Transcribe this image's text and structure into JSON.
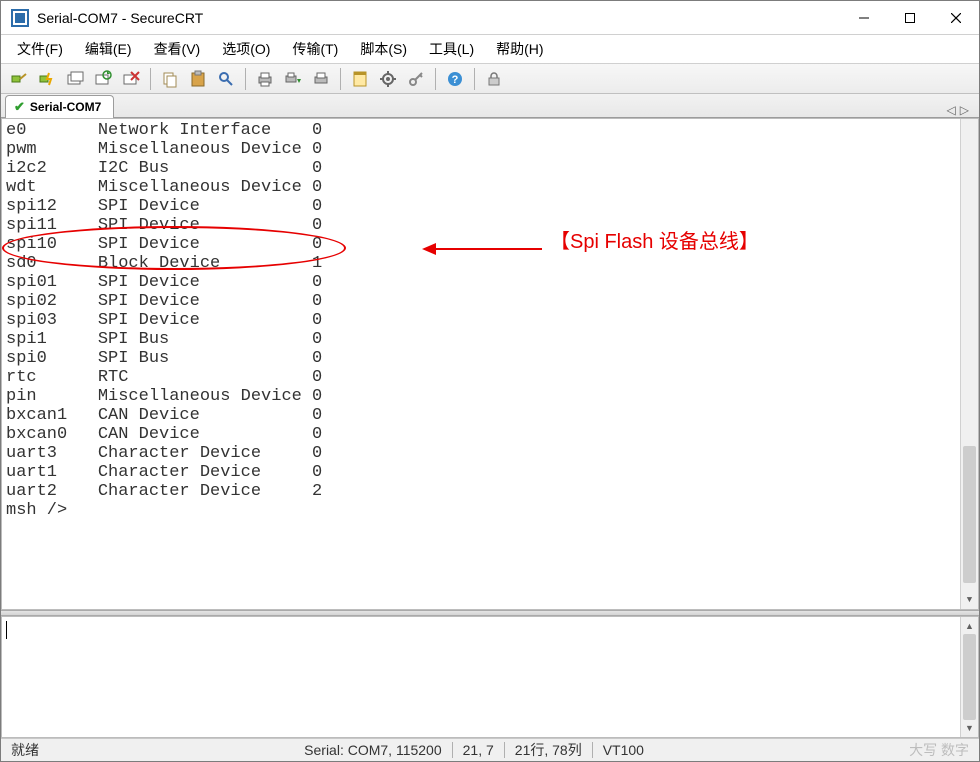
{
  "window": {
    "title": "Serial-COM7 - SecureCRT"
  },
  "menu": {
    "file": "文件(F)",
    "edit": "编辑(E)",
    "view": "查看(V)",
    "options": "选项(O)",
    "transfer": "传输(T)",
    "scripts": "脚本(S)",
    "tools": "工具(L)",
    "help": "帮助(H)"
  },
  "tab": {
    "name": "Serial-COM7"
  },
  "terminal": {
    "rows": [
      {
        "name": "e0",
        "type": "Network Interface",
        "ref": "0"
      },
      {
        "name": "pwm",
        "type": "Miscellaneous Device",
        "ref": "0"
      },
      {
        "name": "i2c2",
        "type": "I2C Bus",
        "ref": "0"
      },
      {
        "name": "wdt",
        "type": "Miscellaneous Device",
        "ref": "0"
      },
      {
        "name": "spi12",
        "type": "SPI Device",
        "ref": "0"
      },
      {
        "name": "spi11",
        "type": "SPI Device",
        "ref": "0"
      },
      {
        "name": "spi10",
        "type": "SPI Device",
        "ref": "0"
      },
      {
        "name": "sd0",
        "type": "Block Device",
        "ref": "1"
      },
      {
        "name": "spi01",
        "type": "SPI Device",
        "ref": "0"
      },
      {
        "name": "spi02",
        "type": "SPI Device",
        "ref": "0"
      },
      {
        "name": "spi03",
        "type": "SPI Device",
        "ref": "0"
      },
      {
        "name": "spi1",
        "type": "SPI Bus",
        "ref": "0"
      },
      {
        "name": "spi0",
        "type": "SPI Bus",
        "ref": "0"
      },
      {
        "name": "rtc",
        "type": "RTC",
        "ref": "0"
      },
      {
        "name": "pin",
        "type": "Miscellaneous Device",
        "ref": "0"
      },
      {
        "name": "bxcan1",
        "type": "CAN Device",
        "ref": "0"
      },
      {
        "name": "bxcan0",
        "type": "CAN Device",
        "ref": "0"
      },
      {
        "name": "uart3",
        "type": "Character Device",
        "ref": "0"
      },
      {
        "name": "uart1",
        "type": "Character Device",
        "ref": "0"
      },
      {
        "name": "uart2",
        "type": "Character Device",
        "ref": "2"
      }
    ],
    "prompt": "msh />"
  },
  "annotation": {
    "label": "【Spi Flash 设备总线】"
  },
  "status": {
    "ready": "就绪",
    "serial": "Serial: COM7, 115200",
    "cursor": "21,  7",
    "size": "21行, 78列",
    "term": "VT100",
    "caps": "大写 数字"
  }
}
